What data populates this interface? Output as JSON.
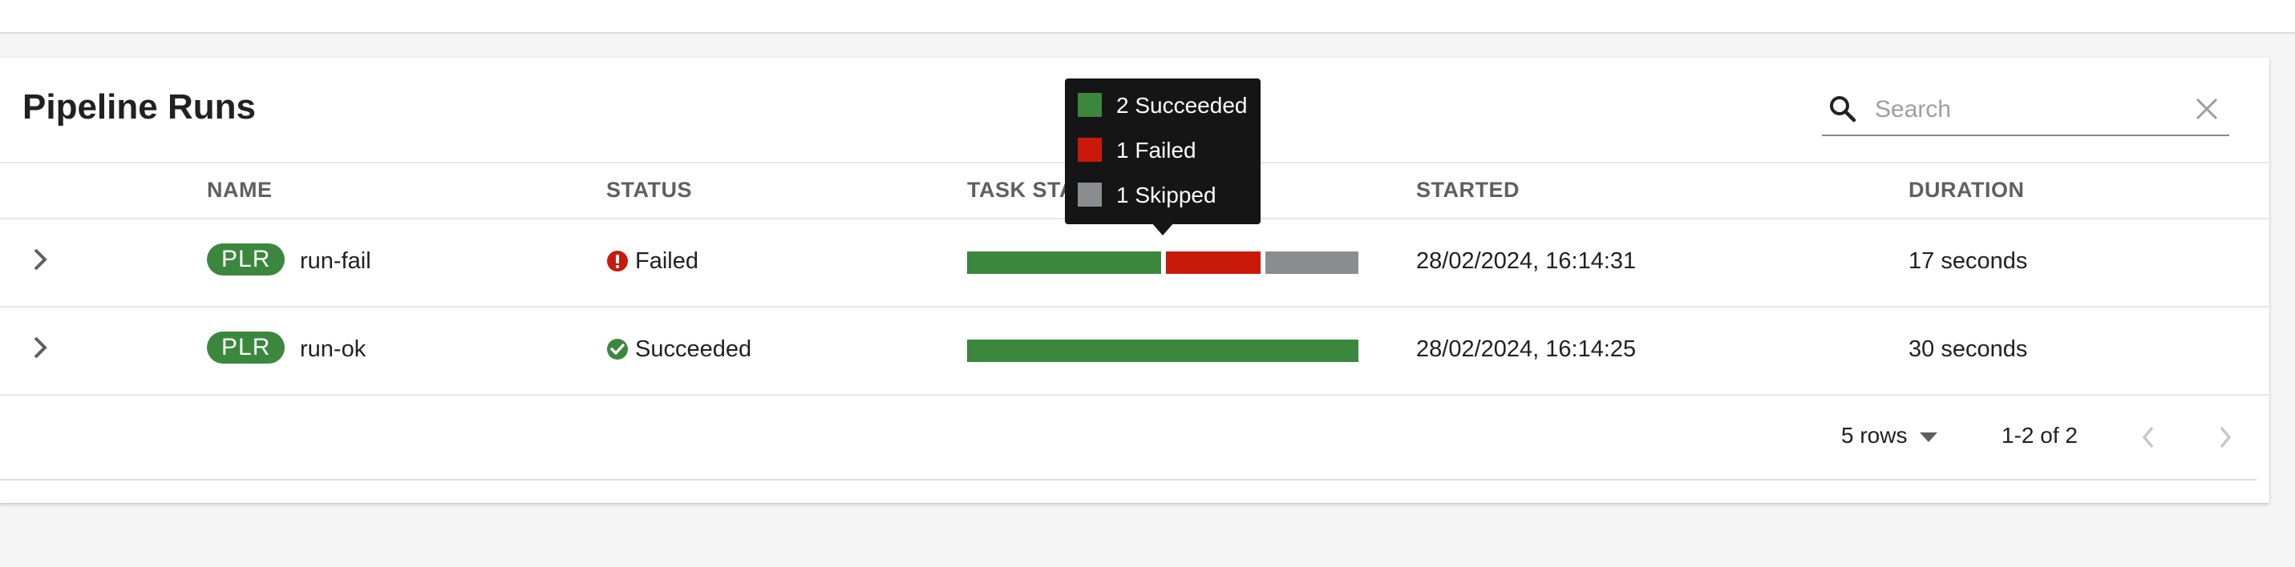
{
  "page": {
    "title": "Pipeline Runs"
  },
  "search": {
    "placeholder": "Search",
    "value": ""
  },
  "table": {
    "columns": {
      "name": "NAME",
      "status": "STATUS",
      "task_status": "TASK STATUS",
      "started": "STARTED",
      "duration": "DURATION"
    },
    "rows": [
      {
        "badge": "PLR",
        "name": "run-fail",
        "status": "Failed",
        "status_icon": "error-circle-icon",
        "task_status": {
          "succeeded": 2,
          "failed": 1,
          "skipped": 1
        },
        "started": "28/02/2024, 16:14:31",
        "duration": "17 seconds"
      },
      {
        "badge": "PLR",
        "name": "run-ok",
        "status": "Succeeded",
        "status_icon": "check-circle-icon",
        "task_status": {
          "succeeded": 1,
          "failed": 0,
          "skipped": 0
        },
        "started": "28/02/2024, 16:14:25",
        "duration": "30 seconds"
      }
    ]
  },
  "tooltip": {
    "items": [
      {
        "label": "2 Succeeded",
        "color": "#3b873e"
      },
      {
        "label": "1 Failed",
        "color": "#c9190b"
      },
      {
        "label": "1 Skipped",
        "color": "#8a8d90"
      }
    ]
  },
  "pagination": {
    "rows_per_page": "5 rows",
    "range": "1-2 of 2"
  },
  "colors": {
    "succeeded": "#3b873e",
    "failed": "#c9190b",
    "skipped": "#8a8d90",
    "badge": "#3b873e"
  },
  "icons": {
    "search": "search-icon",
    "clear": "close-icon",
    "expand": "chevron-right-icon",
    "rows_dropdown": "caret-down-icon",
    "prev": "chevron-left-icon",
    "next": "chevron-right-icon"
  }
}
